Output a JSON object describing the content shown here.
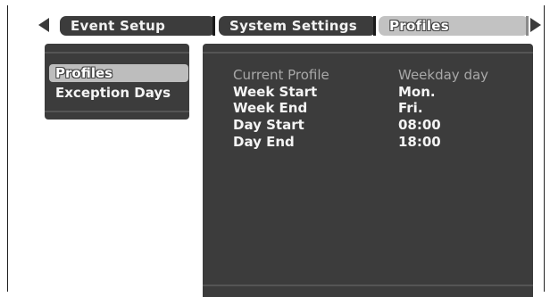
{
  "tabs": [
    {
      "label": "Event Setup",
      "selected": false
    },
    {
      "label": "System Settings",
      "selected": false
    },
    {
      "label": "Profiles",
      "selected": true
    }
  ],
  "menu": {
    "items": [
      {
        "label": "Profiles",
        "selected": true
      },
      {
        "label": "Exception Days",
        "selected": false
      }
    ]
  },
  "profile": {
    "rows": [
      {
        "label": "Current Profile",
        "value": "Weekday day"
      },
      {
        "label": "Week Start",
        "value": "Mon."
      },
      {
        "label": "Week End",
        "value": "Fri."
      },
      {
        "label": "Day Start",
        "value": "08:00"
      },
      {
        "label": "Day End",
        "value": "18:00"
      }
    ]
  },
  "colors": {
    "panel": "#3c3c3c",
    "selected": "#bdbdbd",
    "text": "#f4f4f4",
    "dim_text": "#a8a8a8"
  },
  "icons": {
    "prev": "triangle-left-icon",
    "next": "triangle-right-icon"
  }
}
